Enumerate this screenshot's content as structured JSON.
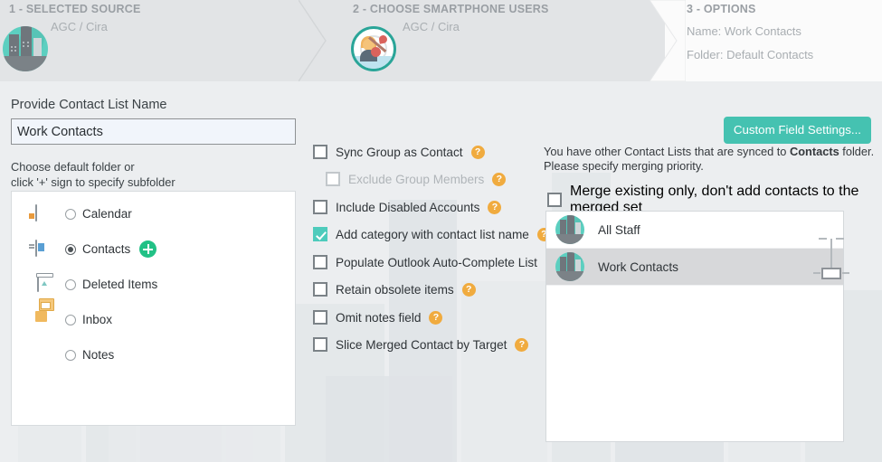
{
  "steps": [
    {
      "title": "1 - SELECTED SOURCE",
      "sub": "AGC / Cira",
      "icon": "city-icon"
    },
    {
      "title": "2 - CHOOSE SMARTPHONE USERS",
      "sub": "AGC / Cira",
      "icon": "target-icon"
    },
    {
      "title": "3 - OPTIONS",
      "name_line": "Name: Work Contacts",
      "folder_line": "Folder: Default Contacts"
    }
  ],
  "left": {
    "list_name_label": "Provide Contact List Name",
    "list_name_value": "Work Contacts",
    "choose_folder_label": "Choose default folder or\nclick '+' sign to specify subfolder",
    "choose_folder_line1": "Choose default folder or",
    "choose_folder_line2": "click '+' sign to specify subfolder",
    "folders": [
      {
        "label": "Calendar",
        "selected": false,
        "icon": "calendar-icon",
        "has_plus": false
      },
      {
        "label": "Contacts",
        "selected": true,
        "icon": "contacts-card-icon",
        "has_plus": true
      },
      {
        "label": "Deleted Items",
        "selected": false,
        "icon": "trash-icon",
        "has_plus": false
      },
      {
        "label": "Inbox",
        "selected": false,
        "icon": "inbox-icon",
        "has_plus": false
      },
      {
        "label": "Notes",
        "selected": false,
        "icon": "notes-icon",
        "has_plus": false
      }
    ]
  },
  "options": [
    {
      "label": "Sync Group as Contact",
      "checked": false,
      "disabled": false,
      "indent": false,
      "help": "?"
    },
    {
      "label": "Exclude Group Members",
      "checked": false,
      "disabled": true,
      "indent": true,
      "help": "?"
    },
    {
      "label": "Include Disabled Accounts",
      "checked": false,
      "disabled": false,
      "indent": false,
      "help": "?"
    },
    {
      "label": "Add category with contact list name",
      "checked": true,
      "disabled": false,
      "indent": false,
      "help": "?"
    },
    {
      "label": "Populate Outlook Auto-Complete List",
      "checked": false,
      "disabled": false,
      "indent": false,
      "help": "?"
    },
    {
      "label": "Retain obsolete items",
      "checked": false,
      "disabled": false,
      "indent": false,
      "help": "?"
    },
    {
      "label": "Omit notes field",
      "checked": false,
      "disabled": false,
      "indent": false,
      "help": "?"
    },
    {
      "label": "Slice Merged Contact by Target",
      "checked": false,
      "disabled": false,
      "indent": false,
      "help": "?"
    }
  ],
  "right": {
    "custom_field_button": "Custom Field Settings...",
    "note_prefix": "You have other Contact Lists that are synced to ",
    "note_bold": "Contacts",
    "note_suffix": " folder.",
    "note_line2": "Please specify merging priority.",
    "merge_checkbox_label": "Merge existing only, don't add contacts to the merged set",
    "merge_checked": false,
    "contact_lists": [
      {
        "label": "All Staff",
        "selected": false,
        "icon": "city-icon"
      },
      {
        "label": "Work Contacts",
        "selected": true,
        "icon": "city-icon"
      }
    ],
    "priority_slider": "priority-slider"
  },
  "colors": {
    "accent_teal": "#45c2b1",
    "check_teal": "#4ecbbc",
    "help_orange": "#f0ab3f",
    "plus_green": "#22c186",
    "header_bg": "#e2e4e6",
    "page_bg": "#eceef0"
  }
}
